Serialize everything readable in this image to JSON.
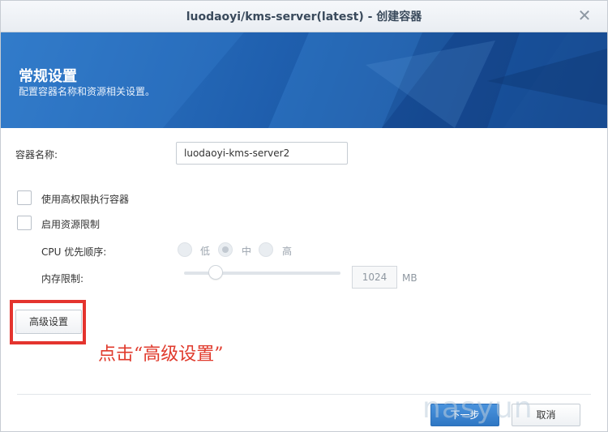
{
  "window": {
    "title": "luodaoyi/kms-server(latest) - 创建容器"
  },
  "banner": {
    "heading": "常规设置",
    "subheading": "配置容器名称和资源相关设置。"
  },
  "form": {
    "container_name_label": "容器名称:",
    "container_name_value": "luodaoyi-kms-server2",
    "privileged_label": "使用高权限执行容器",
    "resource_limit_label": "启用资源限制",
    "cpu_priority_label": "CPU 优先顺序:",
    "cpu_options": [
      "低",
      "中",
      "高"
    ],
    "cpu_selected": "中",
    "memory_limit_label": "内存限制:",
    "memory_value": "1024",
    "memory_unit": "MB",
    "memory_level": 0.2
  },
  "buttons": {
    "advanced": "高级设置",
    "next": "下一步",
    "cancel": "取消"
  },
  "annotation": {
    "text": "点击“高级设置”"
  },
  "watermark": {
    "text": "nasyun"
  },
  "colors": {
    "accent": "#2f77c4",
    "highlight": "#e4342e",
    "banner": "#1f5fae"
  },
  "icons": {
    "close": "close-icon"
  }
}
